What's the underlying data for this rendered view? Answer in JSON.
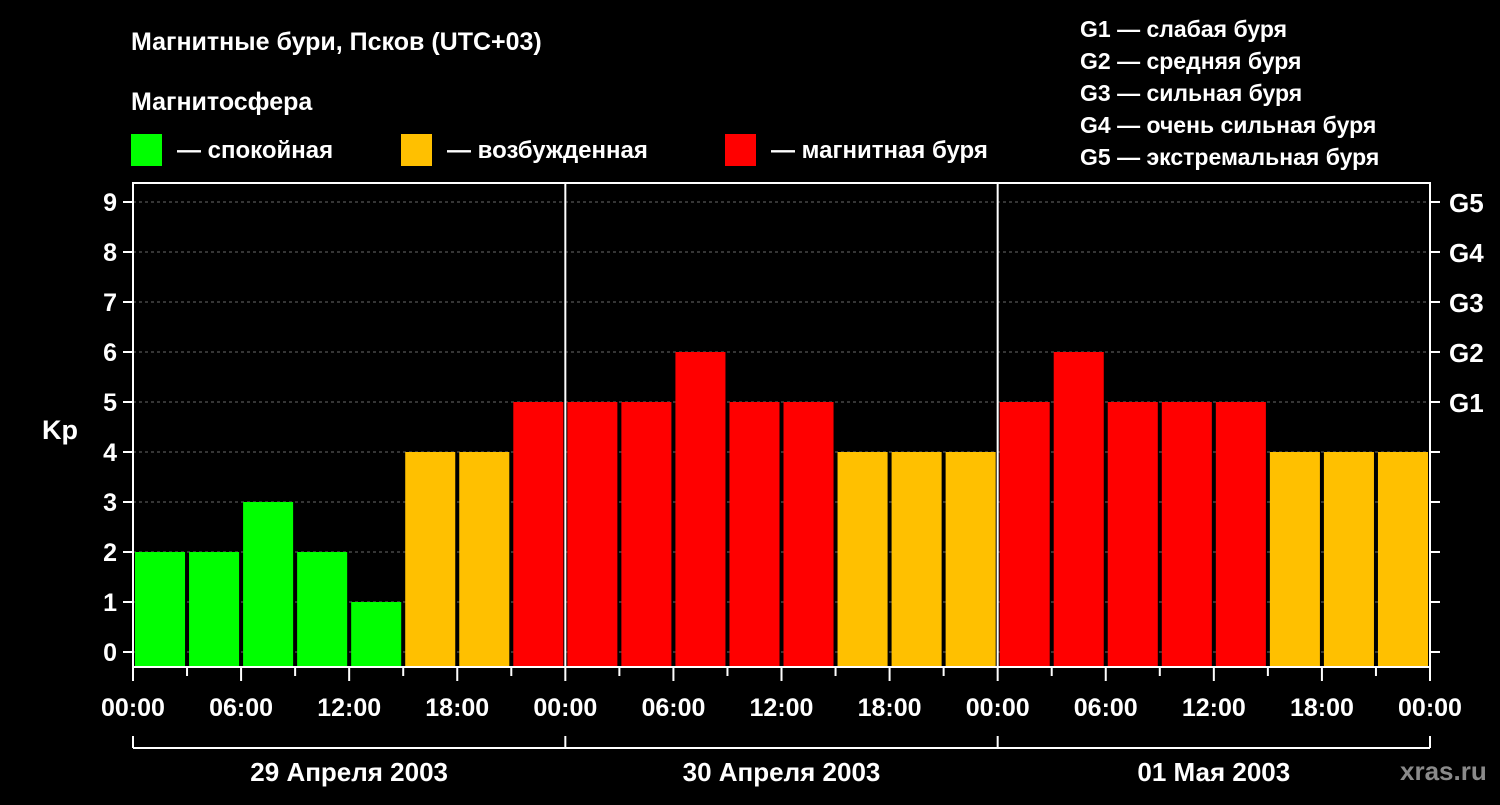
{
  "title": "Магнитные бури, Псков (UTC+03)",
  "legend": {
    "heading": "Магнитосфера",
    "items": [
      {
        "label": "— спокойная",
        "color": "#00ff00"
      },
      {
        "label": "— возбужденная",
        "color": "#ffc000"
      },
      {
        "label": "— магнитная буря",
        "color": "#ff0000"
      }
    ]
  },
  "g_legend": [
    "G1 — слабая буря",
    "G2 — средняя буря",
    "G3 — сильная буря",
    "G4 — очень сильная буря",
    "G5 — экстремальная буря"
  ],
  "watermark": "xras.ru",
  "chart_data": {
    "type": "bar",
    "title": "Магнитные бури, Псков (UTC+03)",
    "ylabel": "Kp",
    "ylim": [
      0,
      9
    ],
    "yticks": [
      "0",
      "1",
      "2",
      "3",
      "4",
      "5",
      "6",
      "7",
      "8",
      "9"
    ],
    "grid": true,
    "right_axis": [
      {
        "value": 5,
        "label": "G1"
      },
      {
        "value": 6,
        "label": "G2"
      },
      {
        "value": 7,
        "label": "G3"
      },
      {
        "value": 8,
        "label": "G4"
      },
      {
        "value": 9,
        "label": "G5"
      }
    ],
    "xticks": [
      "00:00",
      "06:00",
      "12:00",
      "18:00",
      "00:00",
      "06:00",
      "12:00",
      "18:00",
      "00:00",
      "06:00",
      "12:00",
      "18:00",
      "00:00"
    ],
    "days": [
      "29 Апреля 2003",
      "30 Апреля 2003",
      "01 Мая 2003"
    ],
    "interval_hours": 3,
    "values": [
      2,
      2,
      3,
      2,
      1,
      4,
      4,
      5,
      5,
      5,
      6,
      5,
      5,
      4,
      4,
      4,
      5,
      6,
      5,
      5,
      5,
      4,
      4,
      4
    ],
    "colors": {
      "quiet": "#00ff00",
      "active": "#ffc000",
      "storm": "#ff0000"
    }
  }
}
